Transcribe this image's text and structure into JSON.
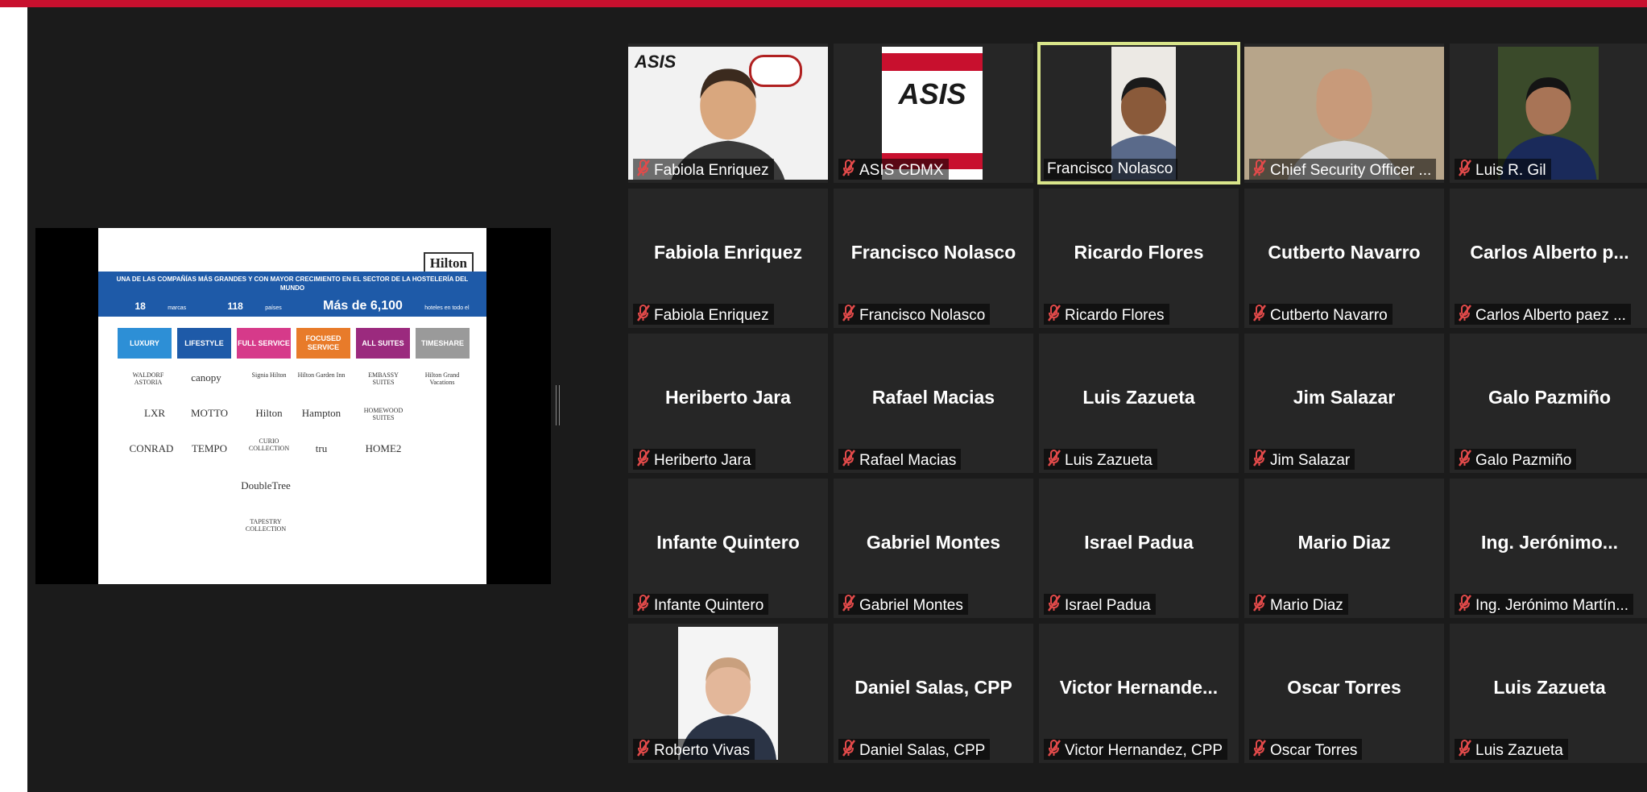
{
  "slide": {
    "logo": "Hilton",
    "headline": "UNA DE LAS COMPAÑÍAS MÁS GRANDES Y CON MAYOR CRECIMIENTO EN EL SECTOR DE LA HOSTELERÍA DEL MUNDO",
    "stat1_value": "18",
    "stat1_label": "marcas",
    "stat2_value": "118",
    "stat2_label": "países",
    "stat3_value": "Más de 6,100",
    "stat3_label": "hoteles en todo el mundo",
    "categories": [
      {
        "label": "LUXURY",
        "color": "#2d8fd6"
      },
      {
        "label": "LIFESTYLE",
        "color": "#1e5aa8"
      },
      {
        "label": "FULL SERVICE",
        "color": "#d63a8a"
      },
      {
        "label": "FOCUSED SERVICE",
        "color": "#e87b2a"
      },
      {
        "label": "ALL SUITES",
        "color": "#9b2a7e"
      },
      {
        "label": "TIMESHARE",
        "color": "#9a9a9a"
      }
    ],
    "brands": [
      "WALDORF ASTORIA",
      "canopy",
      "Signia Hilton",
      "Hilton Garden Inn",
      "EMBASSY SUITES",
      "Hilton Grand Vacations",
      "LXR",
      "MOTTO",
      "Hilton",
      "Hampton",
      "HOMEWOOD SUITES",
      "CONRAD",
      "TEMPO",
      "CURIO COLLECTION",
      "tru",
      "HOME2",
      "DoubleTree",
      "TAPESTRY COLLECTION"
    ]
  },
  "participants": [
    {
      "label": "Fabiola Enriquez",
      "center": "",
      "video": true,
      "muted": true
    },
    {
      "label": "ASIS CDMX",
      "center": "",
      "video": true,
      "muted": true
    },
    {
      "label": "Francisco Nolasco",
      "center": "",
      "video": true,
      "muted": false,
      "active": true
    },
    {
      "label": "Chief Security Officer ...",
      "center": "",
      "video": true,
      "muted": true
    },
    {
      "label": "Luis R. Gil",
      "center": "",
      "video": true,
      "muted": true
    },
    {
      "label": "Fabiola Enriquez",
      "center": "Fabiola Enriquez",
      "muted": true
    },
    {
      "label": "Francisco Nolasco",
      "center": "Francisco Nolasco",
      "muted": true
    },
    {
      "label": "Ricardo Flores",
      "center": "Ricardo Flores",
      "muted": true
    },
    {
      "label": "Cutberto Navarro",
      "center": "Cutberto Navarro",
      "muted": true
    },
    {
      "label": "Carlos Alberto paez ...",
      "center": "Carlos  Alberto  p...",
      "muted": true
    },
    {
      "label": "Heriberto Jara",
      "center": "Heriberto Jara",
      "muted": true
    },
    {
      "label": "Rafael Macias",
      "center": "Rafael Macias",
      "muted": true
    },
    {
      "label": "Luis Zazueta",
      "center": "Luis Zazueta",
      "muted": true
    },
    {
      "label": "Jim Salazar",
      "center": "Jim Salazar",
      "muted": true
    },
    {
      "label": "Galo Pazmiño",
      "center": "Galo Pazmiño",
      "muted": true
    },
    {
      "label": "Infante Quintero",
      "center": "Infante Quintero",
      "muted": true
    },
    {
      "label": "Gabriel Montes",
      "center": "Gabriel Montes",
      "muted": true
    },
    {
      "label": "Israel Padua",
      "center": "Israel Padua",
      "muted": true
    },
    {
      "label": "Mario Diaz",
      "center": "Mario Diaz",
      "muted": true
    },
    {
      "label": "Ing. Jerónimo Martín...",
      "center": "Ing.  Jerónimo...",
      "muted": true
    },
    {
      "label": "Roberto Vivas",
      "center": "",
      "video": true,
      "muted": true
    },
    {
      "label": "Daniel Salas, CPP",
      "center": "Daniel Salas, CPP",
      "muted": true
    },
    {
      "label": "Victor Hernandez, CPP",
      "center": "Victor  Hernande...",
      "muted": true
    },
    {
      "label": "Oscar Torres",
      "center": "Oscar Torres",
      "muted": true
    },
    {
      "label": "Luis Zazueta",
      "center": "Luis Zazueta",
      "muted": true
    }
  ],
  "video_text": {
    "asis_logo": "ASIS"
  }
}
